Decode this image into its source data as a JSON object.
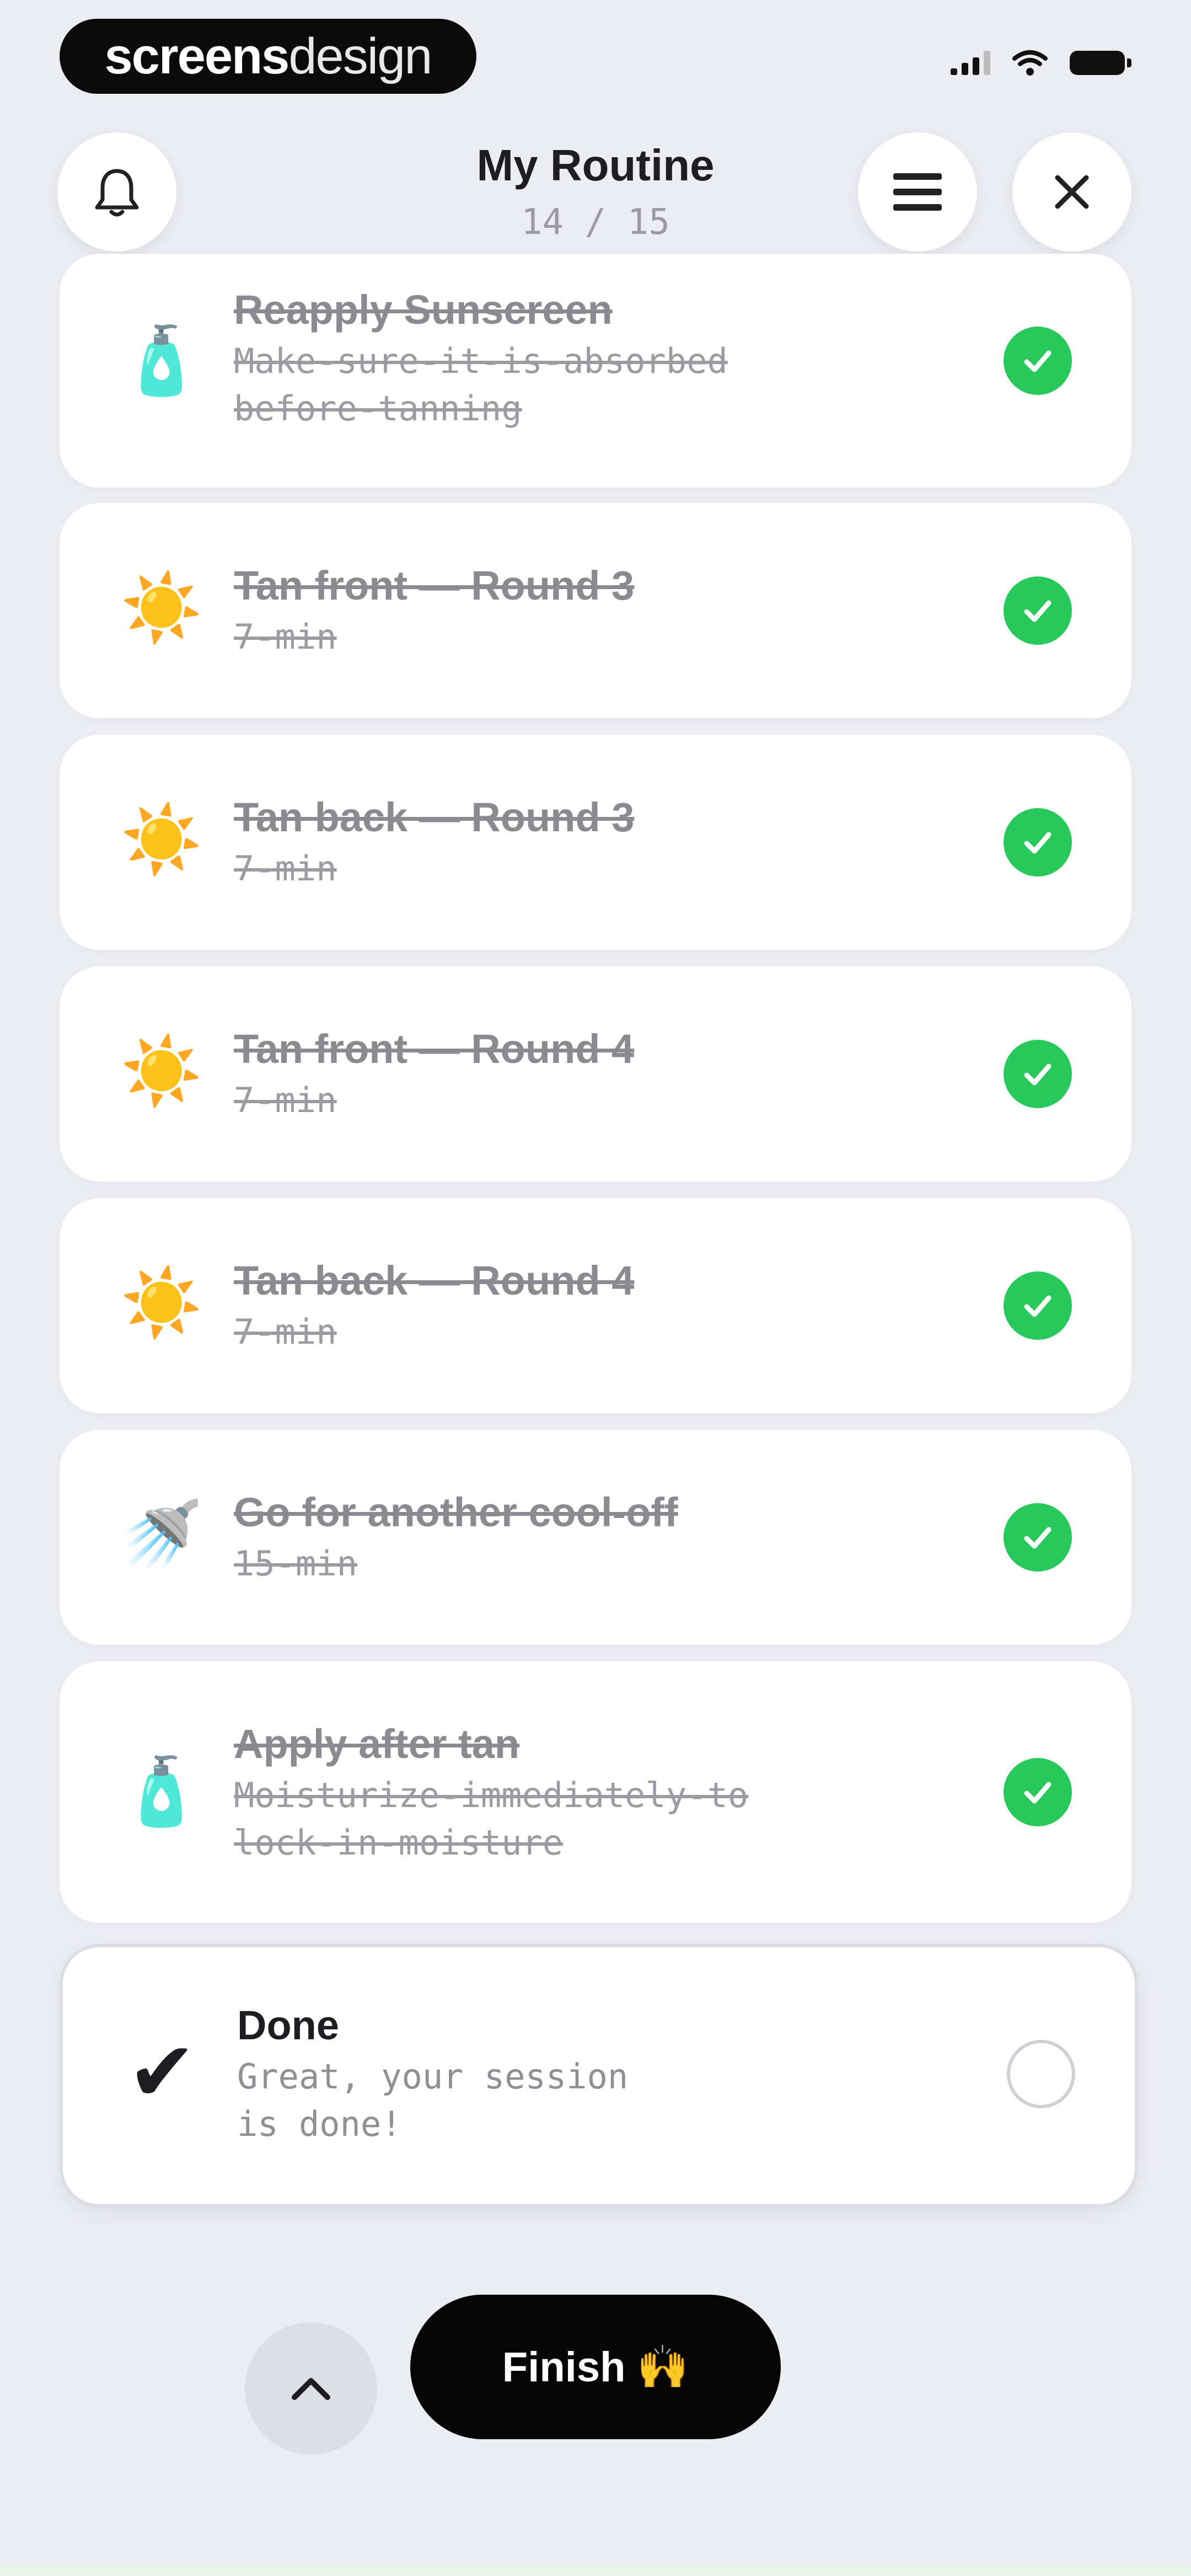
{
  "status_bar": {
    "watermark_bold": "screens",
    "watermark_light": "design"
  },
  "header": {
    "title": "My Routine",
    "progress": "14 / 15"
  },
  "icons": {
    "bell": "bell-icon",
    "list": "list-icon",
    "close": "close-icon"
  },
  "items": [
    {
      "emoji": "🧴",
      "title": "Reapply Sunscreen",
      "subtitle": "Make-sure-it-is-absorbed\nbefore-tanning",
      "done": true
    },
    {
      "emoji": "☀️",
      "title": "Tan front — Round 3",
      "subtitle": "7-min",
      "done": true
    },
    {
      "emoji": "☀️",
      "title": "Tan back — Round 3",
      "subtitle": "7-min",
      "done": true
    },
    {
      "emoji": "☀️",
      "title": "Tan front — Round 4",
      "subtitle": "7-min",
      "done": true
    },
    {
      "emoji": "☀️",
      "title": "Tan back — Round 4",
      "subtitle": "7-min",
      "done": true
    },
    {
      "emoji": "🚿",
      "title": "Go for another cool-off",
      "subtitle": "15-min",
      "done": true
    },
    {
      "emoji": "🧴",
      "title": "Apply after tan",
      "subtitle": "Moisturize-immediately-to\nlock-in-moisture",
      "done": true
    },
    {
      "emoji": "✔",
      "title": "Done",
      "subtitle": "Great, your session\nis done!",
      "done": false
    }
  ],
  "footer": {
    "finish_label": "Finish",
    "finish_emoji": "🙌"
  },
  "colors": {
    "background": "#ecedf2",
    "check": "#27c95a",
    "button": "#050505"
  }
}
